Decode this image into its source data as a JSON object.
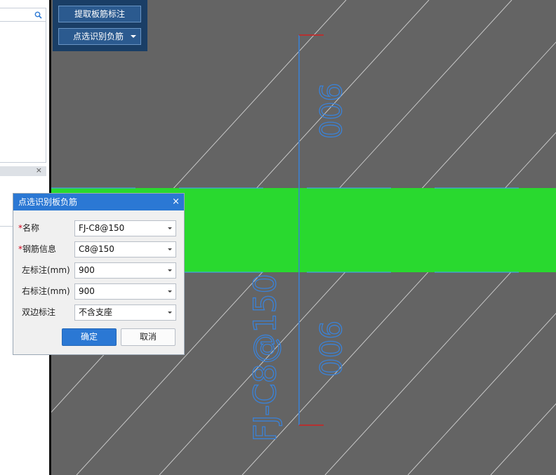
{
  "toolbar": {
    "extract_label": "提取板筋标注",
    "pick_label": "点选识别负筋"
  },
  "left_panel": {
    "search_icon": "search-icon",
    "close_glyph": "×"
  },
  "canvas": {
    "dimension_top": "900",
    "dimension_bottom": "900",
    "rebar_label": "FJ-C8@150",
    "colors": {
      "background": "#646464",
      "slab_band": "#29d92f",
      "dimension_line": "#3a82d8",
      "end_tick": "#d02020",
      "hatch": "#c8c8c8"
    }
  },
  "dialog": {
    "title": "点选识别板负筋",
    "close_glyph": "×",
    "required_mark": "*",
    "fields": [
      {
        "label": "名称",
        "required": true,
        "value": "FJ-C8@150"
      },
      {
        "label": "钢筋信息",
        "required": true,
        "value": "C8@150"
      },
      {
        "label": "左标注(mm)",
        "required": false,
        "value": "900"
      },
      {
        "label": "右标注(mm)",
        "required": false,
        "value": "900"
      },
      {
        "label": "双边标注",
        "required": false,
        "value": "不含支座"
      }
    ],
    "ok_label": "确定",
    "cancel_label": "取消"
  }
}
